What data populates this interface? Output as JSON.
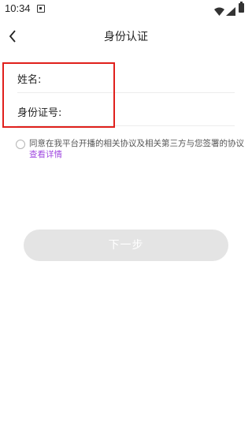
{
  "status_bar": {
    "time": "10:34",
    "icons": [
      "notification-a-icon",
      "wifi-icon",
      "signal-icon",
      "battery-icon"
    ]
  },
  "header": {
    "title": "身份认证",
    "back_icon": "chevron-left-icon"
  },
  "form": {
    "name_label": "姓名:",
    "name_value": "",
    "name_placeholder": "",
    "id_label": "身份证号:",
    "id_value": "",
    "id_placeholder": ""
  },
  "agreement": {
    "checked": false,
    "text": "同意在我平台开播的相关协议及相关第三方与您签署的协议",
    "link_text": "查看详情"
  },
  "actions": {
    "next_label": "下一步"
  },
  "colors": {
    "highlight_border": "#e0201c",
    "link": "#a14be0",
    "button_disabled_bg": "#e4e4e4"
  }
}
